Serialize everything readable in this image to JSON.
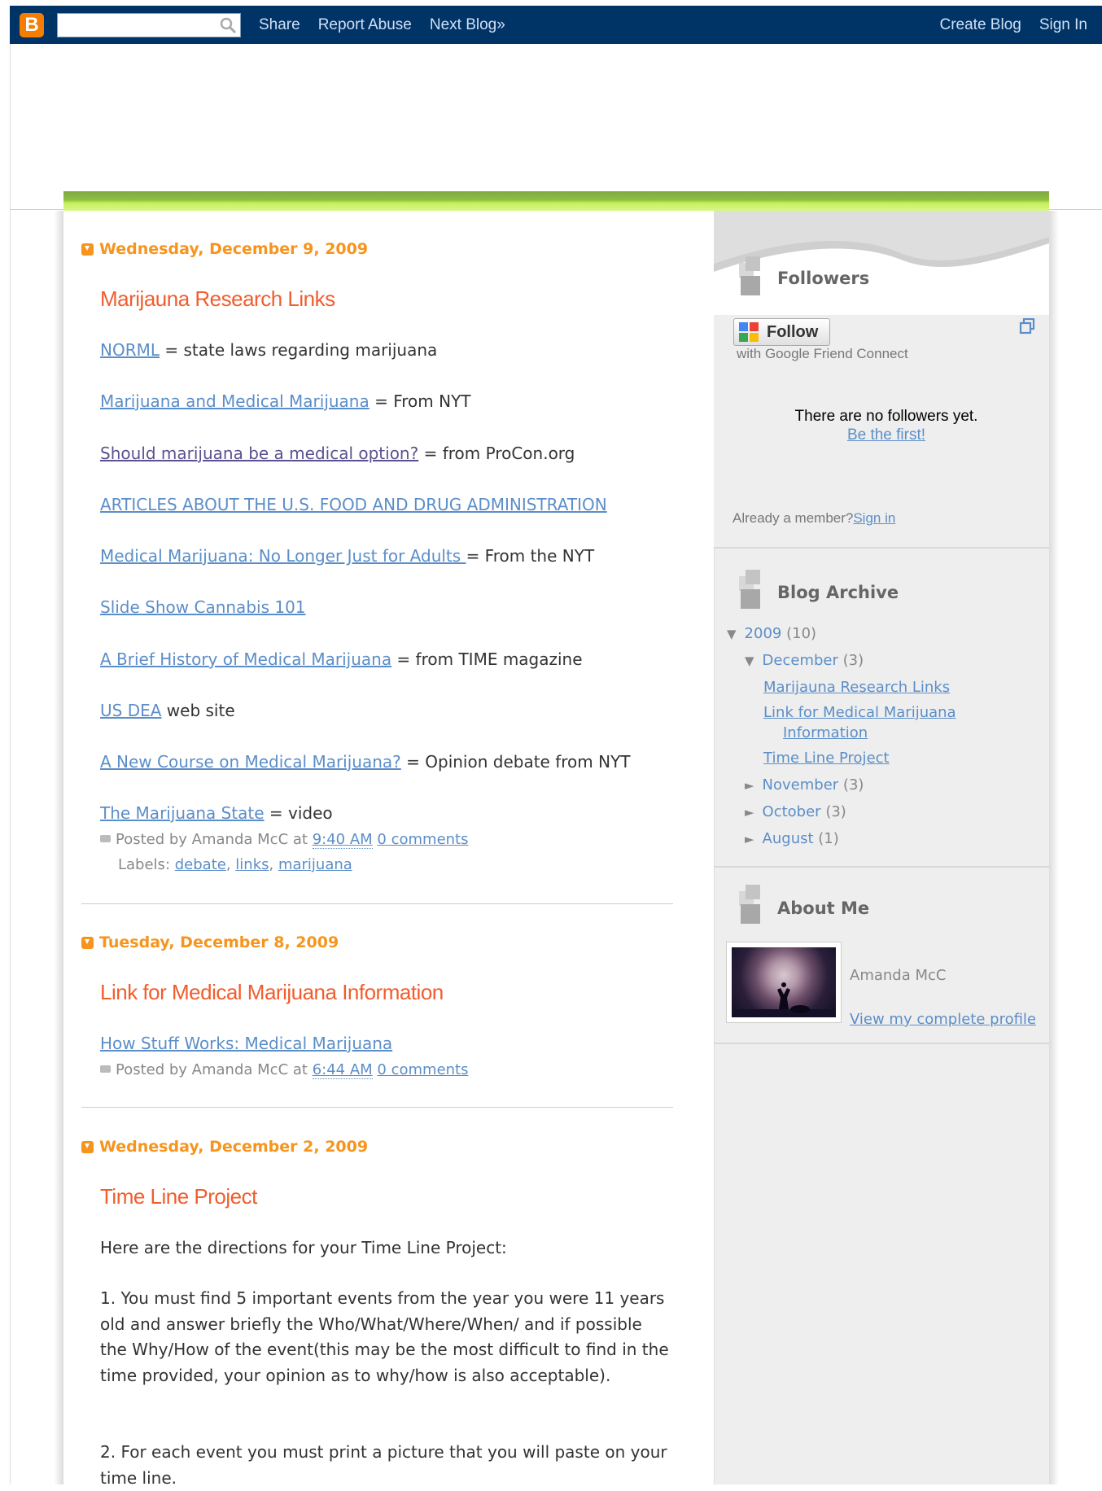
{
  "navbar": {
    "logo": "B",
    "search_value": "",
    "links": [
      "Share",
      "Report Abuse",
      "Next Blog»"
    ],
    "right_links": [
      "Create Blog",
      "Sign In"
    ]
  },
  "posts": [
    {
      "date": "Wednesday, December 9, 2009",
      "title": "Marijauna Research Links",
      "lines": [
        {
          "link": "NORML",
          "text": " = state laws regarding marijuana"
        },
        {
          "link": "Marijuana and Medical Marijuana",
          "text": " = From NYT"
        },
        {
          "link": "Should marijuana be a medical option?",
          "text": " = from ProCon.org"
        },
        {
          "link": "ARTICLES ABOUT THE U.S. FOOD AND DRUG ADMINISTRATION",
          "text": ""
        },
        {
          "link": "Medical Marijuana: No Longer Just for Adults ",
          "text": "= From the NYT"
        },
        {
          "link": "Slide Show Cannabis 101",
          "text": ""
        },
        {
          "link": "A Brief History of Medical Marijuana",
          "text": " = from TIME magazine"
        },
        {
          "link": "US DEA",
          "text": " web site"
        },
        {
          "link": "A New Course on Medical Marijuana?",
          "text": " = Opinion debate from NYT"
        },
        {
          "link": "The Marijuana State",
          "text": " = video"
        }
      ],
      "posted_by": "Posted by Amanda McC at ",
      "time": "9:40 AM",
      "comments": "0 comments",
      "labels_prefix": "Labels: ",
      "labels": [
        "debate",
        "links",
        "marijuana"
      ]
    },
    {
      "date": "Tuesday, December 8, 2009",
      "title": "Link for Medical Marijuana Information",
      "lines": [
        {
          "link": "How Stuff Works: Medical Marijuana",
          "text": ""
        }
      ],
      "posted_by": "Posted by Amanda McC at ",
      "time": "6:44 AM",
      "comments": "0 comments"
    },
    {
      "date": "Wednesday, December 2, 2009",
      "title": "Time Line Project",
      "intro": "Here are the directions for your Time Line Project:",
      "step1": "1. You must find 5 important events from the year you were 11 years old and answer briefly the Who/What/Where/When/ and if possible the Why/How of the event(this may be the most difficult to find in the time provided, your opinion as to why/how is also acceptable).",
      "step2": "2. For each event you must print a picture that you will paste on your time line."
    }
  ],
  "sidebar": {
    "followers": {
      "title": "Followers",
      "follow_label": "Follow",
      "gfc_text": "with Google Friend Connect",
      "no_followers": "There are no followers yet.",
      "be_first": "Be the first!",
      "already_member": "Already a member?",
      "sign_in": "Sign in"
    },
    "archive": {
      "title": "Blog Archive",
      "year": "2009",
      "year_count": "(10)",
      "months": [
        {
          "name": "December",
          "count": "(3)",
          "expanded": true
        },
        {
          "name": "November",
          "count": "(3)",
          "expanded": false
        },
        {
          "name": "October",
          "count": "(3)",
          "expanded": false
        },
        {
          "name": "August",
          "count": "(1)",
          "expanded": false
        }
      ],
      "posts": [
        "Marijauna Research Links",
        "Link for Medical Marijuana ",
        "Information",
        "Time Line Project"
      ],
      "toggle_open": "▼",
      "toggle_closed": "►"
    },
    "about": {
      "title": "About Me",
      "name": "Amanda McC",
      "profile_link": "View my complete profile"
    }
  },
  "colors": {
    "navbar": "#003366",
    "date": "#f7941d",
    "title": "#f15d2d",
    "link": "#5b8ec8"
  }
}
